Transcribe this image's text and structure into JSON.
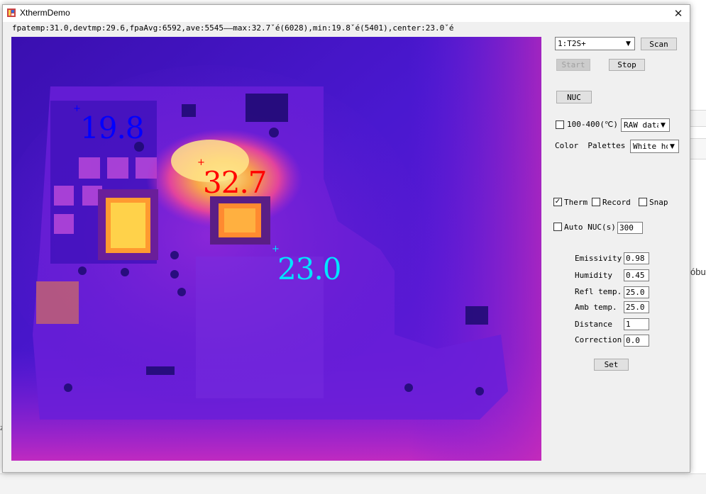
{
  "window": {
    "title": "XthermDemo"
  },
  "status": {
    "text": "fpatemp:31.0,devtmp:29.6,fpaAvg:6592,ave:5545——max:32.7ˇé(6028),min:19.8ˇé(5401),center:23.0ˇé"
  },
  "readouts": {
    "min": {
      "value": "19.8",
      "color": "#0000ff"
    },
    "max": {
      "value": "32.7",
      "color": "#ff0000"
    },
    "center": {
      "value": "23.0",
      "color": "#00e5ff"
    }
  },
  "controls": {
    "device_select": "1:T2S+",
    "scan_label": "Scan",
    "start_label": "Start",
    "stop_label": "Stop",
    "nuc_label": "NUC",
    "range_label": "100-400(℃)",
    "range_checked": false,
    "data_select": "RAW data",
    "palette_label": "Color  Palettes",
    "palette_select": "White hot",
    "therm_label": "Therm",
    "therm_checked": true,
    "record_label": "Record",
    "record_checked": false,
    "snap_label": "Snap",
    "snap_checked": false,
    "autonuc_label": "Auto NUC(s)",
    "autonuc_checked": false,
    "autonuc_value": "300",
    "emissivity_label": "Emissivity",
    "emissivity_value": "0.98",
    "humidity_label": "Humidity",
    "humidity_value": "0.45",
    "refl_label": "Refl temp.",
    "refl_value": "25.0",
    "amb_label": "Amb temp.",
    "amb_value": "25.0",
    "distance_label": "Distance",
    "distance_value": "1",
    "correction_label": "Correction",
    "correction_value": "0.0",
    "set_label": "Set"
  },
  "background": {
    "partial_text": "óbu",
    "edge_letter": "z"
  },
  "icons": {
    "close": "close-icon",
    "app": "thermal-app-icon",
    "chevron": "chevron-down-icon",
    "crosshair": "crosshair-icon"
  }
}
